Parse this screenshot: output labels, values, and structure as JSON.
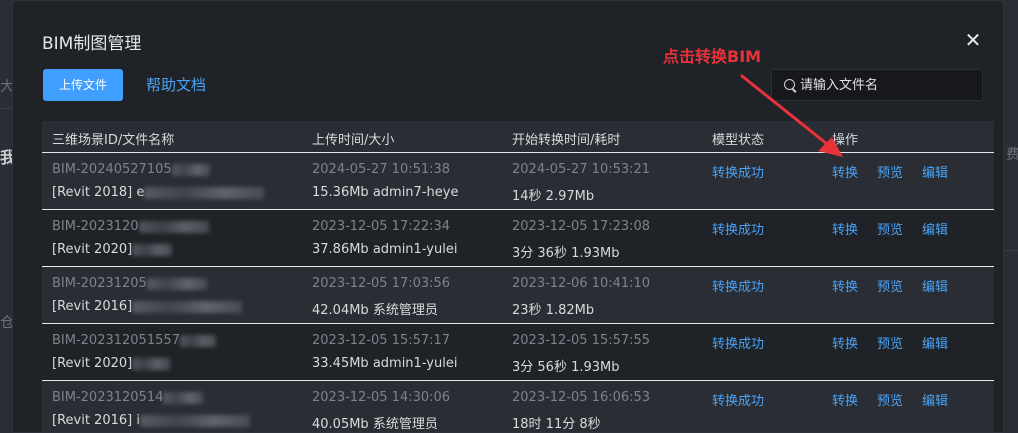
{
  "background": {
    "left_chars": [
      "大",
      "我",
      "仓"
    ],
    "right_chars": [
      "费"
    ]
  },
  "modal": {
    "title": "BIM制图管理",
    "close_glyph": "✕",
    "upload_label": "上传文件",
    "help_label": "帮助文档",
    "search": {
      "placeholder": "请输入文件名",
      "value": ""
    }
  },
  "annotation": {
    "text": "点击转换BIM",
    "color": "#e8323a"
  },
  "table": {
    "headers": [
      "三维场景ID/文件名称",
      "上传时间/大小",
      "开始转换时间/耗时",
      "模型状态",
      "操作"
    ],
    "rows": [
      {
        "id": "BIM-20240527105",
        "file": "[Revit 2018] e",
        "upload_time": "2024-05-27 10:51:38",
        "size_user": "15.36Mb admin7-heye",
        "convert_start": "2024-05-27 10:53:21",
        "duration_size": "14秒 2.97Mb",
        "status": "转换成功",
        "actions": [
          "转换",
          "预览",
          "编辑"
        ]
      },
      {
        "id": "BIM-2023120",
        "file": "[Revit 2020]",
        "upload_time": "2023-12-05 17:22:34",
        "size_user": "37.86Mb admin1-yulei",
        "convert_start": "2023-12-05 17:23:08",
        "duration_size": "3分 36秒 1.93Mb",
        "status": "转换成功",
        "actions": [
          "转换",
          "预览",
          "编辑"
        ]
      },
      {
        "id": "BIM-20231205",
        "file": "[Revit 2016]",
        "upload_time": "2023-12-05 17:03:56",
        "size_user": "42.04Mb 系统管理员",
        "convert_start": "2023-12-06 10:41:10",
        "duration_size": "23秒 1.82Mb",
        "status": "转换成功",
        "actions": [
          "转换",
          "预览",
          "编辑"
        ]
      },
      {
        "id": "BIM-202312051557",
        "file": "[Revit 2020]",
        "upload_time": "2023-12-05 15:57:17",
        "size_user": "33.45Mb admin1-yulei",
        "convert_start": "2023-12-05 15:57:55",
        "duration_size": "3分 56秒 1.93Mb",
        "status": "转换成功",
        "actions": [
          "转换",
          "预览",
          "编辑"
        ]
      },
      {
        "id": "BIM-2023120514",
        "file": "[Revit 2016] i",
        "upload_time": "2023-12-05 14:30:06",
        "size_user": "40.05Mb 系统管理员",
        "convert_start": "2023-12-05 16:06:53",
        "duration_size": "18时 11分 8秒",
        "status": "转换成功",
        "actions": [
          "转换",
          "预览",
          "编辑"
        ]
      }
    ]
  },
  "colors": {
    "accent": "#409eff",
    "link": "#4aa3f7",
    "annotation": "#e8323a"
  }
}
